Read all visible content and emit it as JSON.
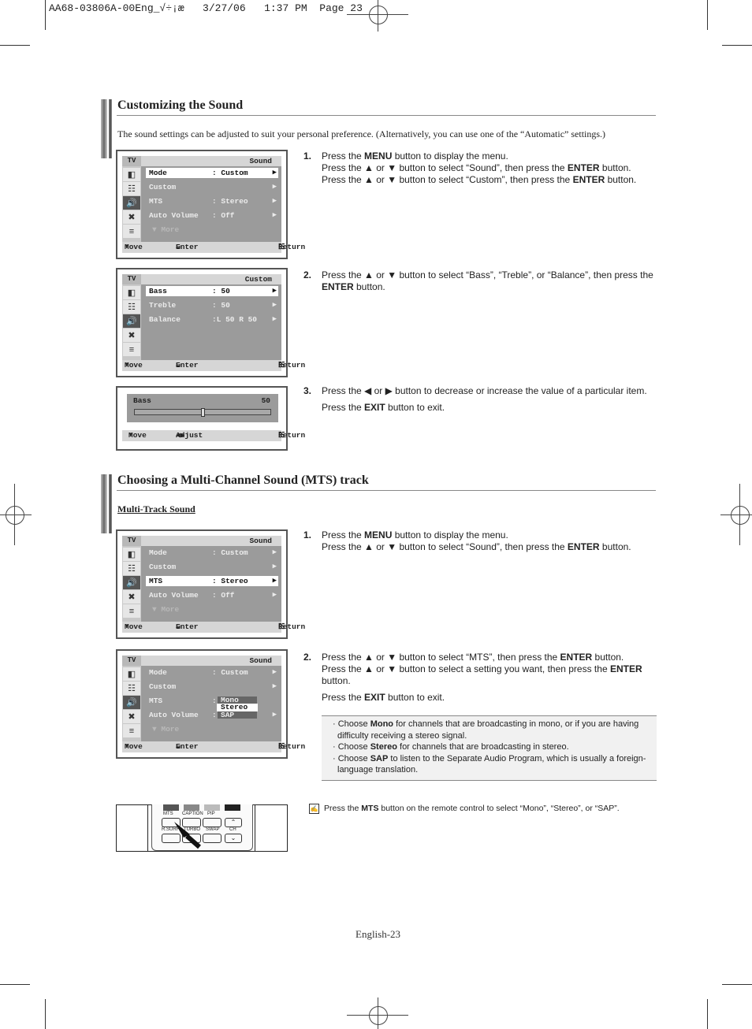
{
  "slug": {
    "file": "AA68-03806A-00Eng_√÷¡æ",
    "date": "3/27/06",
    "time": "1:37 PM",
    "page": "Page 23"
  },
  "section1": {
    "title": "Customizing the Sound",
    "intro": "The sound settings can be adjusted to suit your personal preference. (Alternatively, you can use one of the “Automatic” settings.)",
    "osd1": {
      "tv": "TV",
      "title": "Sound",
      "rows": [
        {
          "label": "Mode",
          "value": ": Custom",
          "highlighted": true
        },
        {
          "label": "Custom",
          "value": "",
          "highlighted": false
        },
        {
          "label": "MTS",
          "value": ": Stereo",
          "highlighted": false
        },
        {
          "label": "Auto Volume",
          "value": ": Off",
          "highlighted": false
        }
      ],
      "more": "▼ More",
      "footer": {
        "move": "Move",
        "enter": "Enter",
        "return": "Return"
      }
    },
    "osd2": {
      "tv": "TV",
      "title": "Custom",
      "rows": [
        {
          "label": "Bass",
          "value": ": 50",
          "highlighted": true
        },
        {
          "label": "Treble",
          "value": ": 50",
          "highlighted": false
        },
        {
          "label": "Balance",
          "value": ":L 50 R 50",
          "highlighted": false
        }
      ],
      "footer": {
        "move": "Move",
        "enter": "Enter",
        "return": "Return"
      }
    },
    "osd3": {
      "label": "Bass",
      "value": "50",
      "slider_fraction": 0.5,
      "footer": {
        "move": "Move",
        "adjust": "Adjust",
        "return": "Return"
      }
    },
    "steps": [
      {
        "num": "1.",
        "lines": [
          "Press the <b>MENU</b> button to display the menu.",
          "Press the ▲ or ▼ button to select “Sound”, then press the <b>ENTER</b> button.",
          "Press the ▲ or ▼ button to select “Custom”, then press the <b>ENTER</b> button."
        ]
      },
      {
        "num": "2.",
        "lines": [
          "Press the ▲ or ▼ button to select “Bass”, “Treble”, or “Balance”, then press the <b>ENTER</b> button."
        ]
      },
      {
        "num": "3.",
        "lines": [
          "Press the ◀ or ▶ button to decrease or increase the value of a particular item."
        ],
        "extra": "Press the <b>EXIT</b> button to exit."
      }
    ]
  },
  "section2": {
    "title": "Choosing a Multi-Channel Sound (MTS) track",
    "subhead": "Multi-Track Sound",
    "osd1": {
      "tv": "TV",
      "title": "Sound",
      "rows": [
        {
          "label": "Mode",
          "value": ": Custom",
          "highlighted": false
        },
        {
          "label": "Custom",
          "value": "",
          "highlighted": false
        },
        {
          "label": "MTS",
          "value": ": Stereo",
          "highlighted": true
        },
        {
          "label": "Auto Volume",
          "value": ": Off",
          "highlighted": false
        }
      ],
      "more": "▼ More",
      "footer": {
        "move": "Move",
        "enter": "Enter",
        "return": "Return"
      }
    },
    "osd2": {
      "tv": "TV",
      "title": "Sound",
      "rows": [
        {
          "label": "Mode",
          "value": ": Custom"
        },
        {
          "label": "Custom",
          "value": ""
        },
        {
          "label": "MTS",
          "value": ":"
        },
        {
          "label": "Auto Volume",
          "value": ":"
        }
      ],
      "mts_options": [
        "Mono",
        "Stereo",
        "SAP"
      ],
      "mts_selected": "Stereo",
      "more": "▼ More",
      "footer": {
        "move": "Move",
        "enter": "Enter",
        "return": "Return"
      }
    },
    "steps": [
      {
        "num": "1.",
        "lines": [
          "Press the <b>MENU</b> button to display the menu.",
          "Press the ▲ or ▼ button to select “Sound”, then press the <b>ENTER</b> button."
        ]
      },
      {
        "num": "2.",
        "lines": [
          "Press the ▲ or ▼ button to select “MTS”, then press the <b>ENTER</b> button. Press the ▲ or ▼ button to select a setting you want, then press the <b>ENTER</b> button."
        ],
        "extra": "Press the <b>EXIT</b> button to exit."
      }
    ],
    "notes": [
      "· Choose <b>Mono</b> for channels that are broadcasting in mono, or if you are having difficulty receiving a stereo signal.",
      "· Choose <b>Stereo</b> for channels that are broadcasting in stereo.",
      "· Choose <b>SAP</b> to listen to the Separate Audio Program, which is usually a foreign-language translation."
    ],
    "remote": {
      "labels": [
        "MTS",
        "CAPTION",
        "PIP",
        "R.SURF",
        "TURBO",
        "SWAP",
        "CH"
      ]
    },
    "tip": "Press the <b>MTS</b> button on the remote control to select “Mono”, “Stereo”, or “SAP”."
  },
  "footer": {
    "page_label": "English-23"
  }
}
